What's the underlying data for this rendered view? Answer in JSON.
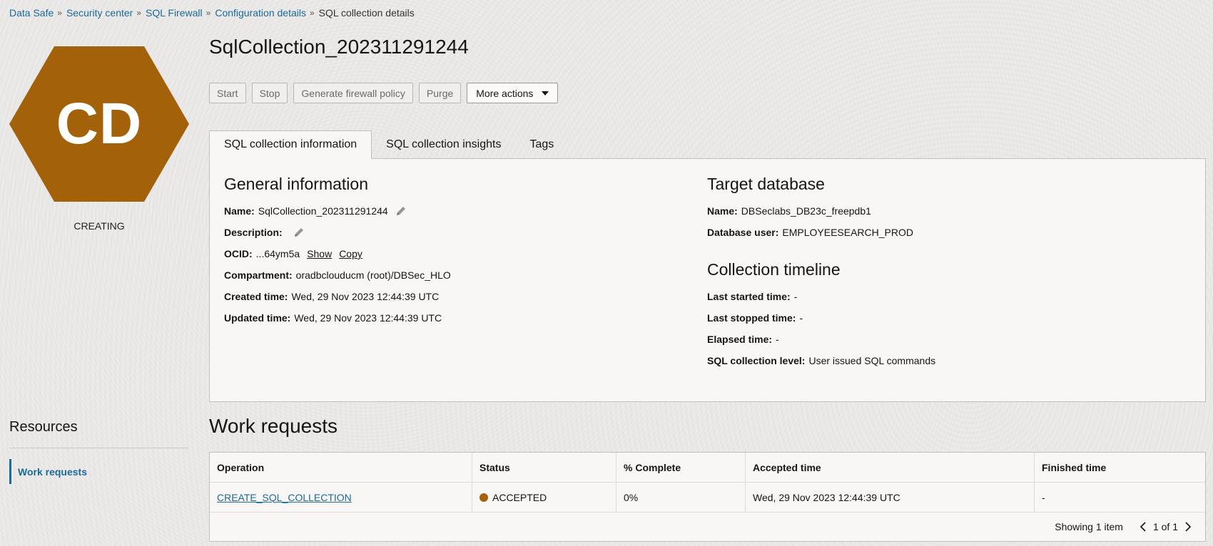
{
  "breadcrumb": {
    "items": [
      "Data Safe",
      "Security center",
      "SQL Firewall",
      "Configuration details"
    ],
    "current": "SQL collection details",
    "separator": "»"
  },
  "resource_badge": {
    "initials": "CD",
    "status": "CREATING",
    "color": "#a3620a"
  },
  "page": {
    "title": "SqlCollection_202311291244"
  },
  "actions": {
    "start": "Start",
    "stop": "Stop",
    "generate": "Generate firewall policy",
    "purge": "Purge",
    "more": "More actions"
  },
  "tabs": [
    "SQL collection information",
    "SQL collection insights",
    "Tags"
  ],
  "general": {
    "title": "General information",
    "name_label": "Name:",
    "name_value": "SqlCollection_202311291244",
    "description_label": "Description:",
    "ocid_label": "OCID:",
    "ocid_value": "...64ym5a",
    "show": "Show",
    "copy": "Copy",
    "compartment_label": "Compartment:",
    "compartment_value": "oradbclouducm (root)/DBSec_HLO",
    "created_label": "Created time:",
    "created_value": "Wed, 29 Nov 2023 12:44:39 UTC",
    "updated_label": "Updated time:",
    "updated_value": "Wed, 29 Nov 2023 12:44:39 UTC"
  },
  "target": {
    "title": "Target database",
    "name_label": "Name:",
    "name_value": "DBSeclabs_DB23c_freepdb1",
    "user_label": "Database user:",
    "user_value": "EMPLOYEESEARCH_PROD"
  },
  "timeline": {
    "title": "Collection timeline",
    "started_label": "Last started time:",
    "started_value": "-",
    "stopped_label": "Last stopped time:",
    "stopped_value": "-",
    "elapsed_label": "Elapsed time:",
    "elapsed_value": "-",
    "level_label": "SQL collection level:",
    "level_value": "User issued SQL commands"
  },
  "resources": {
    "title": "Resources",
    "items": [
      "Work requests"
    ]
  },
  "work_requests": {
    "title": "Work requests",
    "columns": [
      "Operation",
      "Status",
      "% Complete",
      "Accepted time",
      "Finished time"
    ],
    "rows": [
      {
        "operation": "CREATE_SQL_COLLECTION",
        "status": "ACCEPTED",
        "status_color": "#a3620a",
        "complete": "0%",
        "accepted": "Wed, 29 Nov 2023 12:44:39 UTC",
        "finished": "-"
      }
    ],
    "showing": "Showing 1 item",
    "page": "1 of 1"
  }
}
